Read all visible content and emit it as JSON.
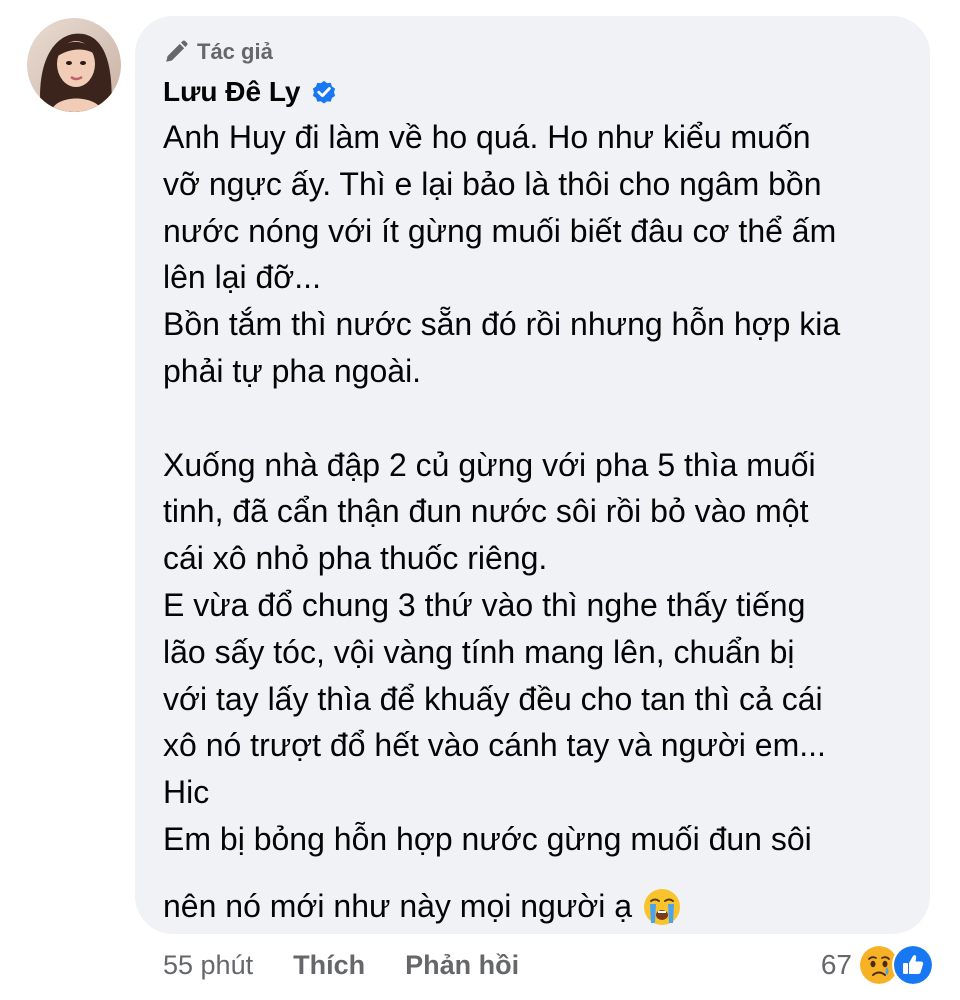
{
  "comment": {
    "author_badge": "Tác giả",
    "author_name": "Lưu Đê Ly",
    "verified": true,
    "body_lines": [
      "Anh Huy đi làm về ho quá. Ho như kiểu muốn",
      "vỡ ngực ấy. Thì e lại bảo là thôi cho ngâm bồn",
      "nước nóng với ít gừng muối biết đâu cơ thể ấm",
      "lên lại đỡ...",
      "Bồn tắm thì nước sẵn đó rồi nhưng hỗn hợp kia",
      "phải tự pha ngoài.",
      "",
      "Xuống nhà đập 2 củ gừng với pha 5 thìa muối",
      "tinh, đã cẩn thận đun nước sôi rồi bỏ vào một",
      "cái xô nhỏ pha thuốc riêng.",
      "E vừa đổ chung 3 thứ vào thì nghe thấy tiếng",
      "lão sấy tóc, vội vàng tính mang lên, chuẩn bị",
      "với tay lấy thìa để khuấy đều cho tan thì cả cái",
      "xô nó trượt đổ hết vào cánh tay và người em...",
      "Hic",
      "Em bị bỏng hỗn hợp nước gừng muối đun sôi"
    ],
    "last_line": "nên nó mới như này mọi người ạ",
    "last_line_emoji": "loudly-crying-face",
    "time": "55 phút",
    "like_label": "Thích",
    "reply_label": "Phản hồi",
    "reaction_count": "67",
    "reactions": [
      "sad",
      "like"
    ]
  },
  "colors": {
    "bubble_bg": "#f0f2f5",
    "secondary_text": "#65676b",
    "primary_text": "#050505",
    "verified_blue": "#1877f2",
    "sad_yellow": "#f7b125",
    "like_blue": "#1877f2"
  }
}
